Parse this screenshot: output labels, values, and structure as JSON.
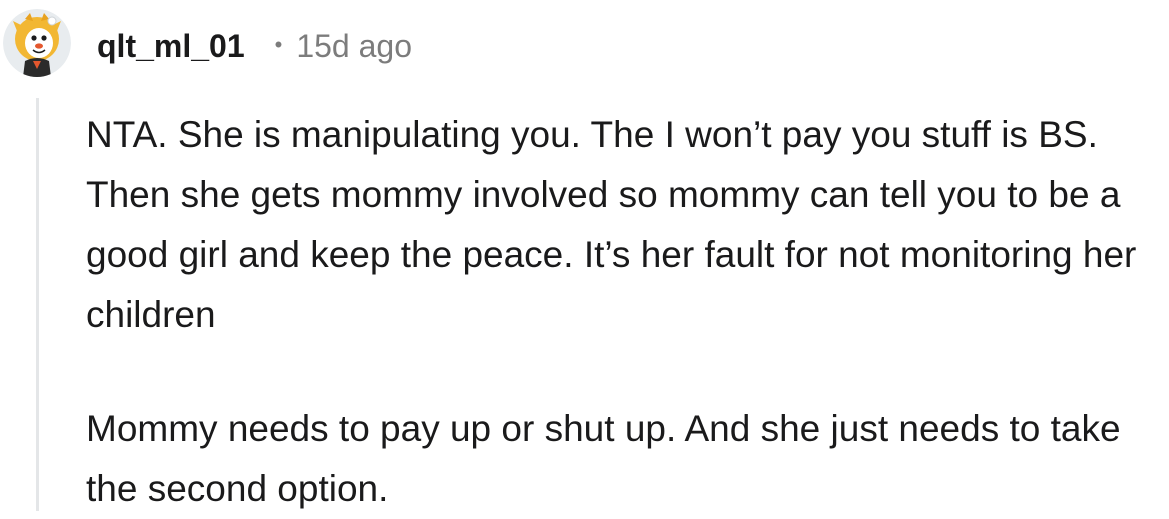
{
  "comment": {
    "username": "qlt_ml_01",
    "separator": "•",
    "timestamp": "15d ago",
    "avatar_icon": "tiger-avatar-icon",
    "paragraphs": [
      "NTA. She is manipulating you. The I won’t pay you stuff is BS. Then she gets mommy involved so mommy can tell you to be a good girl and keep the peace. It’s her fault for not monitoring her children",
      "Mommy needs to pay up or shut up. And she just needs to take the second option."
    ]
  },
  "colors": {
    "text": "#1a1a1b",
    "meta": "#7c7c7c",
    "thread_line": "#e4e6e8",
    "avatar_bg": "#e8ecef"
  }
}
